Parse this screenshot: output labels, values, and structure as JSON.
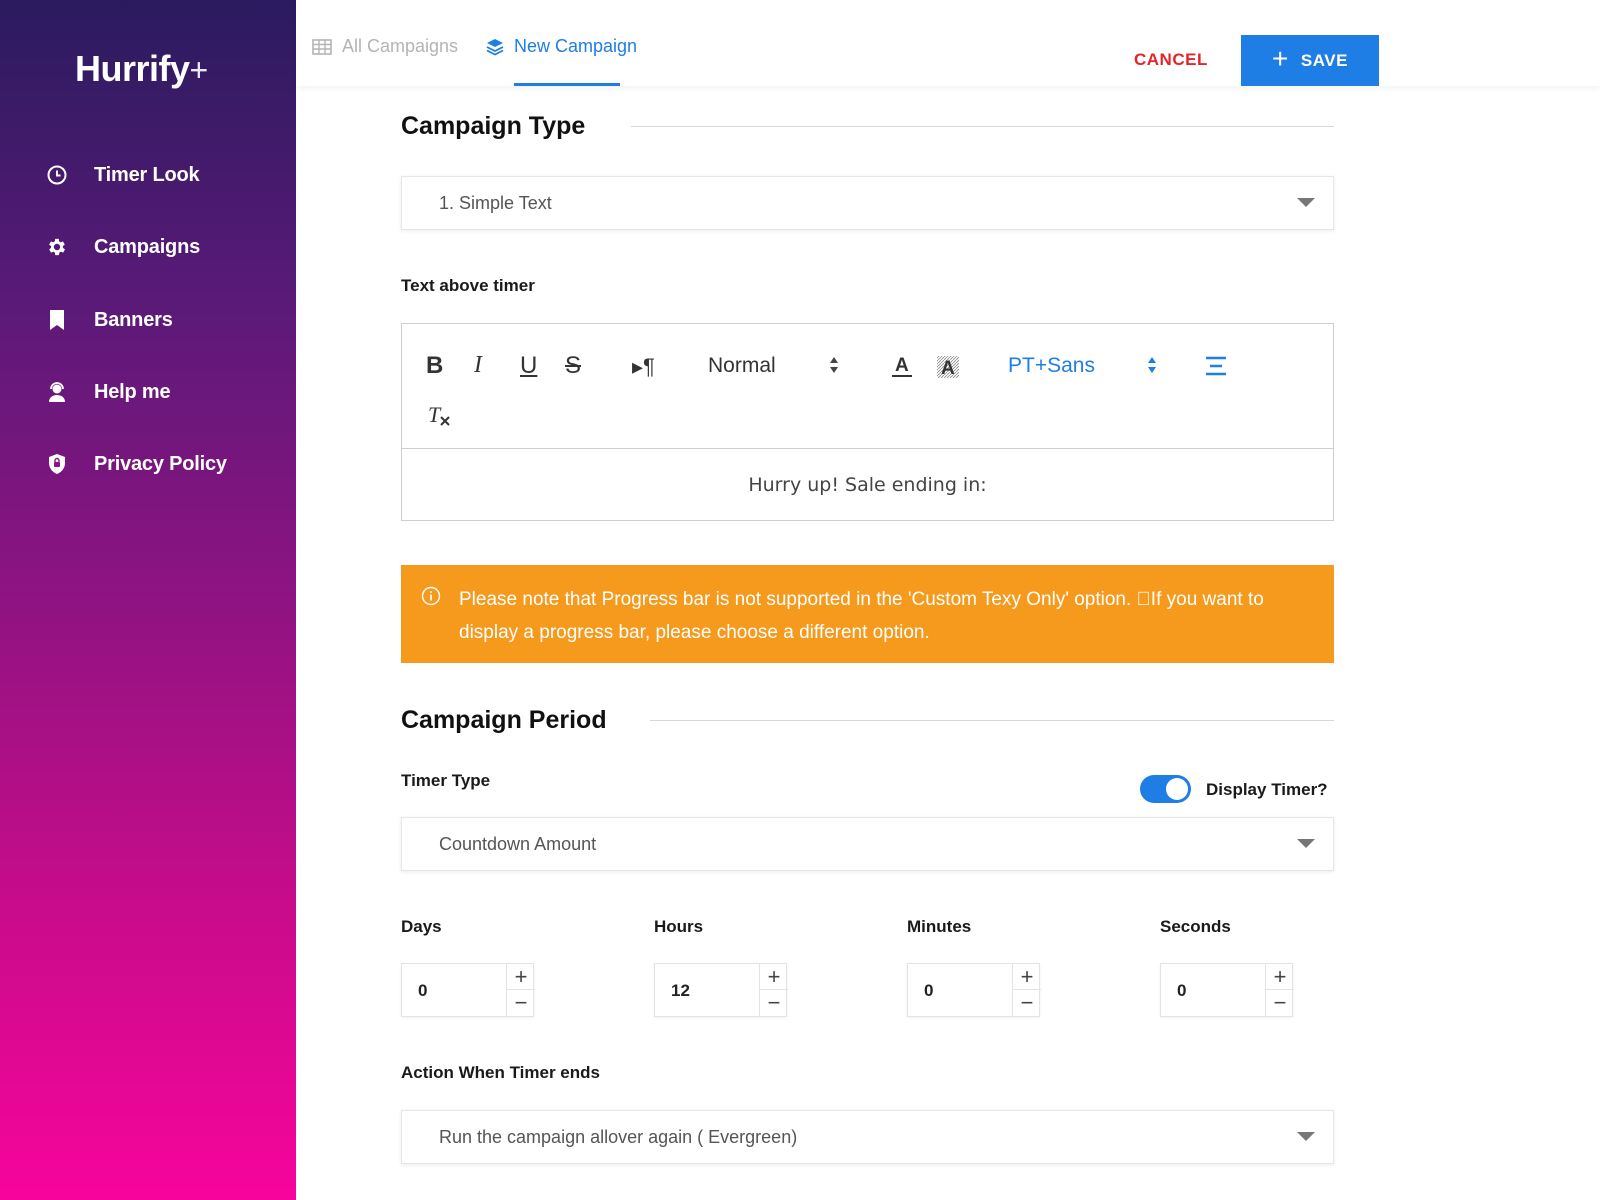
{
  "brand": {
    "name": "Hurrify",
    "suffix": "+"
  },
  "sidebar": {
    "items": [
      {
        "label": "Timer Look",
        "icon": "clock-icon"
      },
      {
        "label": "Campaigns",
        "icon": "gear-icon"
      },
      {
        "label": "Banners",
        "icon": "bookmark-icon"
      },
      {
        "label": "Help me",
        "icon": "support-agent-icon"
      },
      {
        "label": "Privacy Policy",
        "icon": "shield-icon"
      }
    ]
  },
  "topbar": {
    "tabs": [
      {
        "label": "All Campaigns",
        "icon": "table-icon",
        "active": false
      },
      {
        "label": "New Campaign",
        "icon": "layers-icon",
        "active": true
      }
    ],
    "cancel_label": "CANCEL",
    "save_label": "SAVE"
  },
  "colors": {
    "accent": "#1e7ee6",
    "danger": "#e3242b",
    "warning": "#f69a1e"
  },
  "campaign_type": {
    "title": "Campaign Type",
    "selected": "1. Simple Text"
  },
  "editor": {
    "label": "Text above timer",
    "toolbar": {
      "bold": "B",
      "italic": "I",
      "underline": "U",
      "strike": "S",
      "direction": "▸¶",
      "size": "Normal",
      "font": "PT+Sans",
      "clear": "T"
    },
    "content": "Hurry up! Sale ending in:"
  },
  "alert": {
    "text": "Please note that Progress bar is not supported in the 'Custom Texy Only' option. \u0000If you want to display a progress bar, please choose a different option."
  },
  "campaign_period": {
    "title": "Campaign Period",
    "timer_type_label": "Timer Type",
    "display_timer_label": "Display Timer?",
    "display_timer_on": true,
    "timer_type_selected": "Countdown Amount",
    "fields": [
      {
        "label": "Days",
        "value": "0"
      },
      {
        "label": "Hours",
        "value": "12"
      },
      {
        "label": "Minutes",
        "value": "0"
      },
      {
        "label": "Seconds",
        "value": "0"
      }
    ],
    "action_label": "Action When Timer ends",
    "action_selected": "Run the campaign allover again ( Evergreen)"
  }
}
